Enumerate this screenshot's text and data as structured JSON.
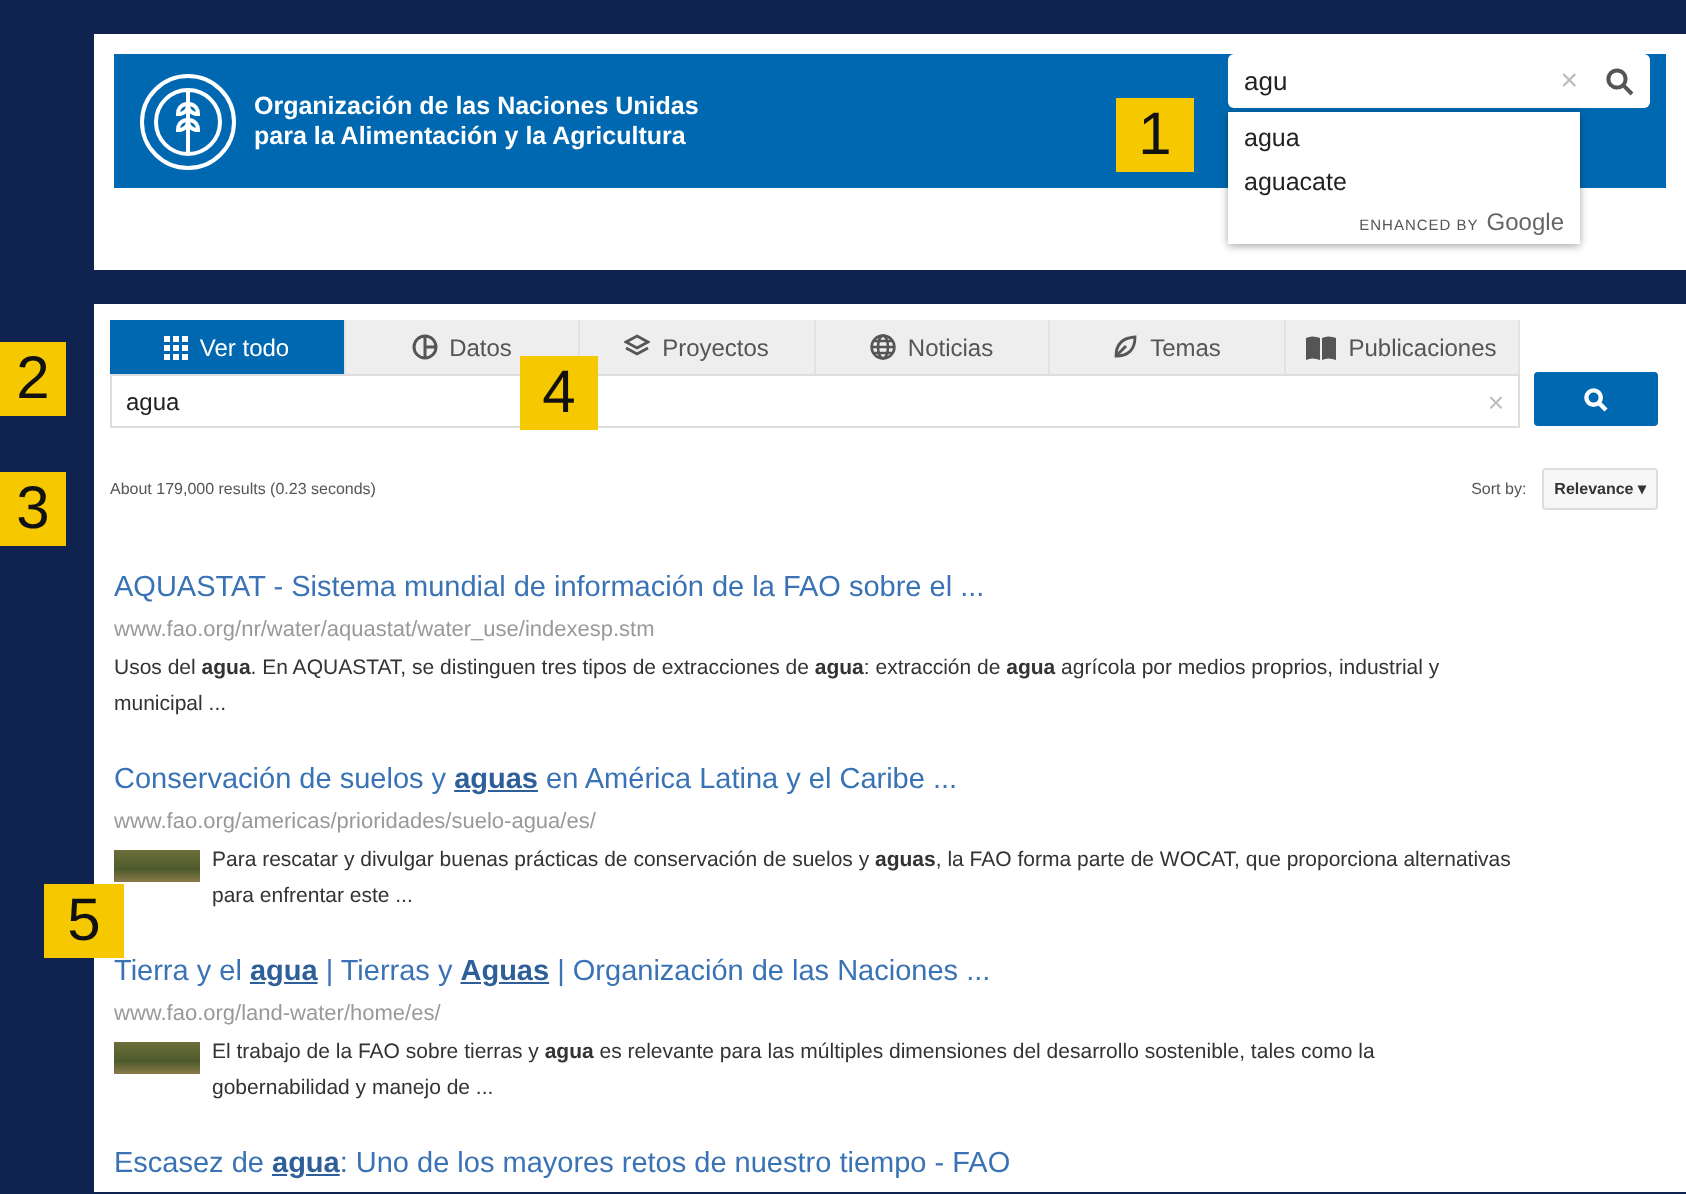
{
  "header": {
    "org_line1": "Organización de las Naciones Unidas",
    "org_line2": "para la Alimentación y la Agricultura",
    "search": {
      "value": "agu",
      "clear_symbol": "×",
      "suggestions": [
        "agua",
        "aguacate"
      ],
      "enhanced_by": "ENHANCED BY",
      "brand": "Google"
    }
  },
  "tabs": [
    {
      "label": "Ver todo",
      "selected": true
    },
    {
      "label": "Datos",
      "selected": false
    },
    {
      "label": "Proyectos",
      "selected": false
    },
    {
      "label": "Noticias",
      "selected": false
    },
    {
      "label": "Temas",
      "selected": false
    },
    {
      "label": "Publicaciones",
      "selected": false
    }
  ],
  "search": {
    "value": "agua",
    "clear_symbol": "×"
  },
  "results_info": "About 179,000 results (0.23 seconds)",
  "sort": {
    "label": "Sort by:",
    "value": "Relevance",
    "caret": "▾"
  },
  "results": [
    {
      "title": "AQUASTAT - Sistema mundial de información de la FAO sobre el ...",
      "url": "www.fao.org/nr/water/aquastat/water_use/indexesp.stm",
      "snippet": "Usos del **agua**. En AQUASTAT, se distinguen tres tipos de extracciones de **agua**: extracción de **agua** agrícola por medios proprios, industrial y municipal ...",
      "thumbnail": false
    },
    {
      "title": "Conservación de suelos y **aguas** en América Latina y el Caribe ...",
      "url": "www.fao.org/americas/prioridades/suelo-agua/es/",
      "snippet": "Para rescatar y divulgar buenas prácticas de conservación de suelos y **aguas**, la FAO forma parte de WOCAT, que proporciona alternativas para enfrentar este ...",
      "thumbnail": true
    },
    {
      "title": "Tierra y el **agua** | Tierras y **Aguas** | Organización de las Naciones ...",
      "url": "www.fao.org/land-water/home/es/",
      "snippet": "El trabajo de la FAO sobre tierras y **agua** es relevante para las múltiples dimensiones del desarrollo sostenible, tales como la gobernabilidad y manejo de ...",
      "thumbnail": true
    },
    {
      "title": "Escasez de **agua**: Uno de los mayores retos de nuestro tiempo - FAO",
      "thumbnail": false
    }
  ],
  "callouts": [
    "1",
    "2",
    "3",
    "4",
    "5"
  ]
}
